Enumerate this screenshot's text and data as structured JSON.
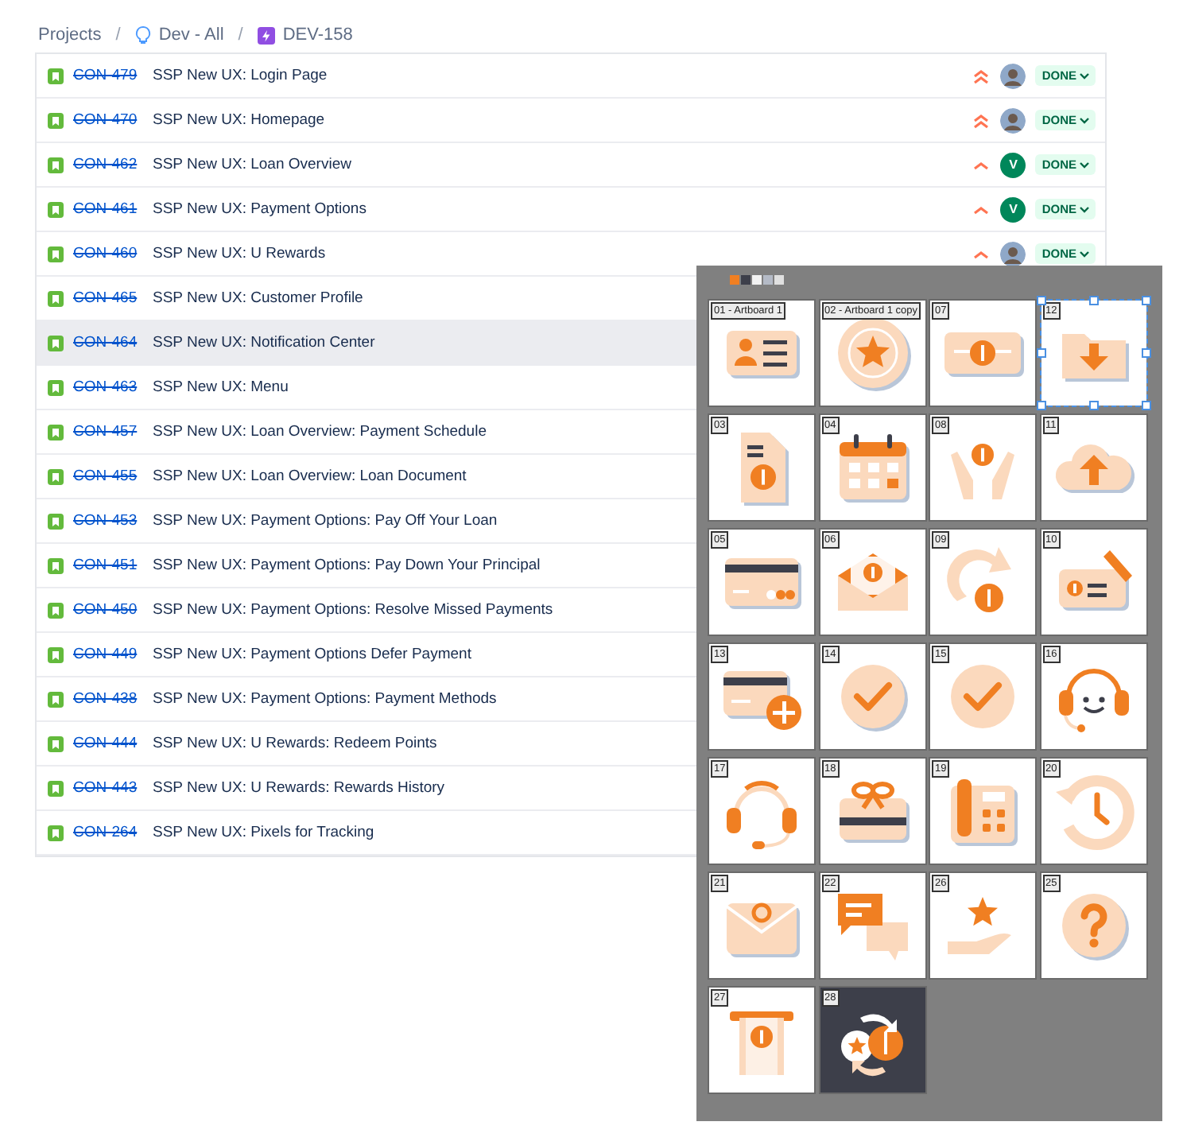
{
  "breadcrumb": [
    {
      "kind": "plain",
      "label": "Projects",
      "separator": "/"
    },
    {
      "kind": "bulb",
      "label": "Dev - All",
      "separator": "/"
    },
    {
      "kind": "epic",
      "label": "DEV-158"
    }
  ],
  "issues": [
    {
      "key": "CON-479",
      "summary": "SSP New UX: Login Page",
      "resolved": true,
      "selected": false,
      "priority": {
        "kind": "highest"
      },
      "avatar": {
        "kind": "photo"
      },
      "status": "DONE"
    },
    {
      "key": "CON-470",
      "summary": "SSP New UX: Homepage",
      "resolved": true,
      "selected": false,
      "priority": {
        "kind": "highest"
      },
      "avatar": {
        "kind": "photo"
      },
      "status": "DONE"
    },
    {
      "key": "CON-462",
      "summary": "SSP New UX: Loan Overview",
      "resolved": true,
      "selected": false,
      "priority": {
        "kind": "high"
      },
      "avatar": {
        "kind": "initial",
        "text": "V",
        "color": "#00875a"
      },
      "status": "DONE"
    },
    {
      "key": "CON-461",
      "summary": "SSP New UX: Payment Options",
      "resolved": true,
      "selected": false,
      "priority": {
        "kind": "high"
      },
      "avatar": {
        "kind": "initial",
        "text": "V",
        "color": "#00875a"
      },
      "status": "DONE"
    },
    {
      "key": "CON-460",
      "summary": "SSP New UX: U Rewards",
      "resolved": true,
      "selected": false,
      "priority": {
        "kind": "high"
      },
      "avatar": {
        "kind": "photo"
      },
      "status": "DONE"
    },
    {
      "key": "CON-465",
      "summary": "SSP New UX: Customer Profile",
      "resolved": true,
      "selected": false
    },
    {
      "key": "CON-464",
      "summary": "SSP New UX: Notification Center",
      "resolved": true,
      "selected": true
    },
    {
      "key": "CON-463",
      "summary": "SSP New UX: Menu",
      "resolved": true,
      "selected": false
    },
    {
      "key": "CON-457",
      "summary": "SSP New UX: Loan Overview: Payment Schedule",
      "resolved": true,
      "selected": false
    },
    {
      "key": "CON-455",
      "summary": "SSP New UX: Loan Overview: Loan Document",
      "resolved": true,
      "selected": false
    },
    {
      "key": "CON-453",
      "summary": "SSP New UX: Payment Options: Pay Off Your Loan",
      "resolved": true,
      "selected": false
    },
    {
      "key": "CON-451",
      "summary": "SSP New UX: Payment Options: Pay Down Your Principal",
      "resolved": true,
      "selected": false
    },
    {
      "key": "CON-450",
      "summary": "SSP New UX: Payment Options: Resolve Missed Payments",
      "resolved": true,
      "selected": false
    },
    {
      "key": "CON-449",
      "summary": "SSP New UX: Payment Options Defer Payment",
      "resolved": true,
      "selected": false
    },
    {
      "key": "CON-438",
      "summary": "SSP New UX: Payment Options: Payment Methods",
      "resolved": true,
      "selected": false
    },
    {
      "key": "CON-444",
      "summary": "SSP New UX: U Rewards: Redeem Points",
      "resolved": true,
      "selected": false
    },
    {
      "key": "CON-443",
      "summary": "SSP New UX: U Rewards: Rewards History",
      "resolved": true,
      "selected": false
    },
    {
      "key": "CON-264",
      "summary": "SSP New UX: Pixels for Tracking",
      "resolved": true,
      "selected": false
    }
  ],
  "artboard_panel": {
    "swatches": [
      {
        "color": "#f07f22"
      },
      {
        "color": "#3d3f4a"
      },
      {
        "color": "#f2f2f2"
      },
      {
        "color": "#b4bac6"
      },
      {
        "color": "#e0e0e0"
      }
    ],
    "artboards": [
      {
        "label": "01 - Artboard 1",
        "selected": false,
        "dark": false
      },
      {
        "label": "02 - Artboard 1 copy",
        "selected": false,
        "dark": false
      },
      {
        "label": "07",
        "selected": false,
        "dark": false
      },
      {
        "label": "12",
        "selected": true,
        "dark": false
      },
      {
        "label": "03",
        "selected": false,
        "dark": false
      },
      {
        "label": "04",
        "selected": false,
        "dark": false
      },
      {
        "label": "08",
        "selected": false,
        "dark": false
      },
      {
        "label": "11",
        "selected": false,
        "dark": false
      },
      {
        "label": "05",
        "selected": false,
        "dark": false
      },
      {
        "label": "06",
        "selected": false,
        "dark": false
      },
      {
        "label": "09",
        "selected": false,
        "dark": false
      },
      {
        "label": "10",
        "selected": false,
        "dark": false
      },
      {
        "label": "13",
        "selected": false,
        "dark": false
      },
      {
        "label": "14",
        "selected": false,
        "dark": false
      },
      {
        "label": "15",
        "selected": false,
        "dark": false
      },
      {
        "label": "16",
        "selected": false,
        "dark": false
      },
      {
        "label": "17",
        "selected": false,
        "dark": false
      },
      {
        "label": "18",
        "selected": false,
        "dark": false
      },
      {
        "label": "19",
        "selected": false,
        "dark": false
      },
      {
        "label": "20",
        "selected": false,
        "dark": false
      },
      {
        "label": "21",
        "selected": false,
        "dark": false
      },
      {
        "label": "22",
        "selected": false,
        "dark": false
      },
      {
        "label": "26",
        "selected": false,
        "dark": false
      },
      {
        "label": "25",
        "selected": false,
        "dark": false
      },
      {
        "label": "27",
        "selected": false,
        "dark": false
      },
      {
        "label": "28",
        "selected": false,
        "dark": true
      }
    ]
  }
}
